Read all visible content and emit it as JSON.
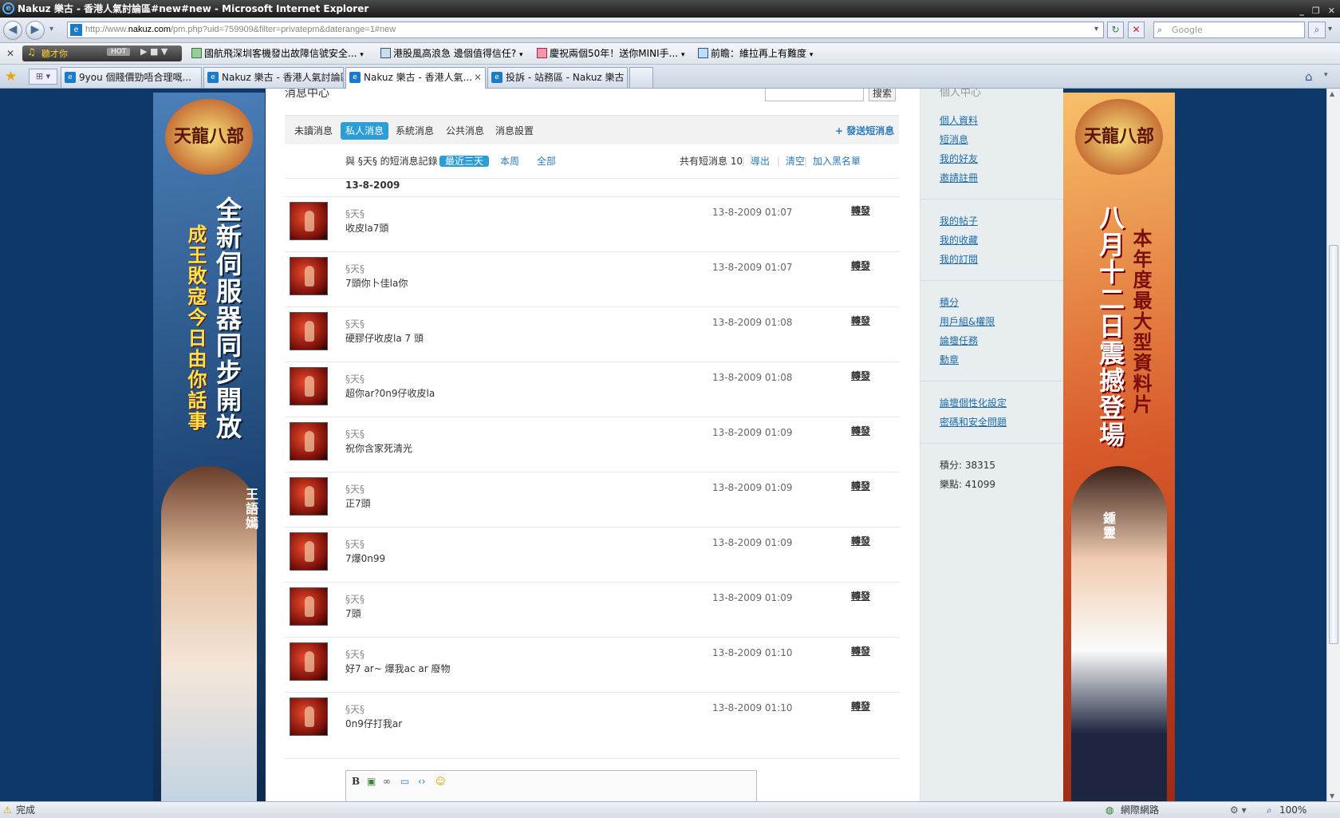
{
  "window": {
    "title": "Nakuz 樂古 - 香港人氣討論區#new#new - Microsoft Internet Explorer",
    "controls": [
      "_",
      "❐",
      "✕"
    ]
  },
  "address": {
    "url_prefix": "http://www.",
    "url_domain": "nakuz.com",
    "url_path": "/pm.php?uid=759909&filter=privatepm&daterange=1#new",
    "search_placeholder": "Google"
  },
  "toolbar": {
    "radio_label": "聽才你",
    "hot_label": "HOT",
    "items": [
      "國航飛深圳客機發出故障信號安全...",
      "港股風高浪急 邊個值得信任?",
      "慶祝兩個50年！送你MINI手...",
      "前瞻：維拉再上有難度"
    ]
  },
  "tabs": [
    {
      "label": "9you 個賤價勁唔合理嘅..."
    },
    {
      "label": "Nakuz 樂古 - 香港人氣討論區"
    },
    {
      "label": "Nakuz 樂古 - 香港人氣..."
    },
    {
      "label": "投訴 - 站務區 - Nakuz 樂古 ..."
    }
  ],
  "ads": {
    "left": {
      "logo": "天龍八部",
      "headline": "全新伺服器同步開放",
      "sub": "成王敗寇今日由你話事",
      "name": "王語嫣"
    },
    "right": {
      "logo": "天龍八部",
      "headline": "本年度最大型資料片",
      "sub": "八月十二日震撼登場",
      "name": "鍾靈"
    }
  },
  "main": {
    "page_title": "消息中心",
    "search_button": "搜索",
    "nav_tabs": [
      "未讀消息",
      "私人消息",
      "系統消息",
      "公共消息",
      "消息設置"
    ],
    "active_tab_index": 1,
    "send_pm": "+ 發送短消息",
    "filter": {
      "prefix": "與 §天§ 的短消息記錄：",
      "options": [
        "最近三天",
        "本周",
        "全部"
      ],
      "count_text": "共有短消息 10",
      "actions": [
        "導出",
        "清空",
        "加入黑名單"
      ]
    },
    "date_heading": "13-8-2009",
    "forward_label": "轉發",
    "messages": [
      {
        "from": "§天§",
        "text": "收皮la7頭",
        "time": "13-8-2009 01:07"
      },
      {
        "from": "§天§",
        "text": "7頭你卜佳la你",
        "time": "13-8-2009 01:07"
      },
      {
        "from": "§天§",
        "text": "硬膠仔收皮la 7 頭",
        "time": "13-8-2009 01:08"
      },
      {
        "from": "§天§",
        "text": "超你ar?0n9仔收皮la",
        "time": "13-8-2009 01:08"
      },
      {
        "from": "§天§",
        "text": "祝你含家死清光",
        "time": "13-8-2009 01:09"
      },
      {
        "from": "§天§",
        "text": "正7頭",
        "time": "13-8-2009 01:09"
      },
      {
        "from": "§天§",
        "text": "7爆0n99",
        "time": "13-8-2009 01:09"
      },
      {
        "from": "§天§",
        "text": "7頭",
        "time": "13-8-2009 01:09"
      },
      {
        "from": "§天§",
        "text": "好7 ar~ 爆我ac ar 廢物",
        "time": "13-8-2009 01:10"
      },
      {
        "from": "§天§",
        "text": "0n9仔打我ar",
        "time": "13-8-2009 01:10"
      }
    ]
  },
  "sidebar": {
    "title": "個人中心",
    "group1": [
      "個人資料",
      "短消息",
      "我的好友",
      "邀請註冊"
    ],
    "group2": [
      "我的帖子",
      "我的收藏",
      "我的訂閱"
    ],
    "group3": [
      "積分",
      "用戶組&權限",
      "論壇任務",
      "勳章"
    ],
    "group4": [
      "論壇個性化設定",
      "密碼和安全問題"
    ],
    "stats": [
      "積分: 38315",
      "樂點: 41099"
    ]
  },
  "status": {
    "text": "完成",
    "zone": "網際網路",
    "zoom": "100%"
  },
  "colors": {
    "accent": "#2b9ed8",
    "link": "#1d6ba8",
    "page_bg": "#0d3868"
  }
}
